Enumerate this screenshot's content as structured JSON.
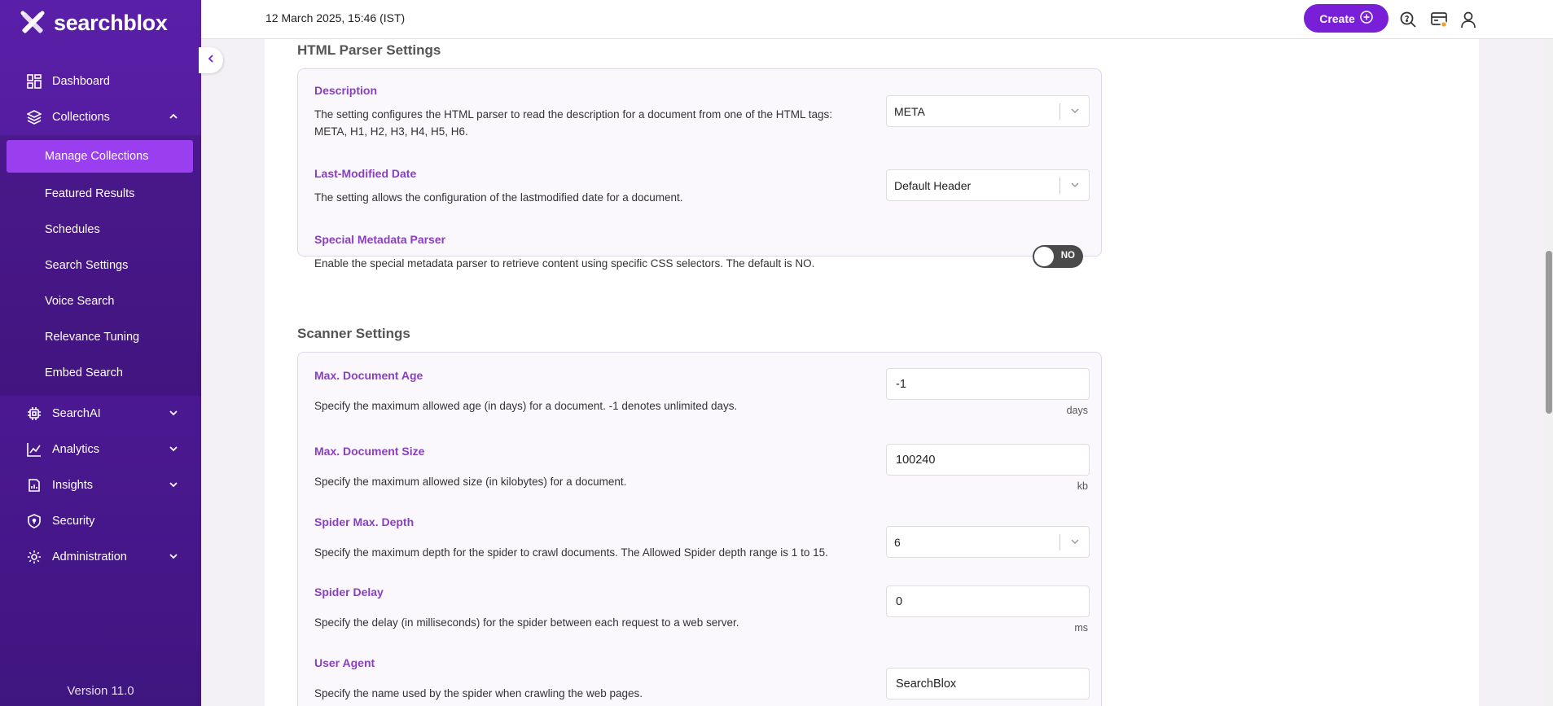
{
  "app": {
    "logo_text": "searchblox",
    "version": "Version 11.0"
  },
  "sidebar": {
    "items": [
      {
        "label": "Dashboard",
        "icon": "dashboard-icon"
      },
      {
        "label": "Collections",
        "icon": "layers-icon",
        "expanded": true,
        "children": [
          "Manage Collections",
          "Featured Results",
          "Schedules",
          "Search Settings",
          "Voice Search",
          "Relevance Tuning",
          "Embed Search"
        ],
        "active_child": "Manage Collections"
      },
      {
        "label": "SearchAI",
        "icon": "chip-icon"
      },
      {
        "label": "Analytics",
        "icon": "chart-icon"
      },
      {
        "label": "Insights",
        "icon": "insights-icon"
      },
      {
        "label": "Security",
        "icon": "shield-icon"
      },
      {
        "label": "Administration",
        "icon": "gear-icon"
      }
    ]
  },
  "topbar": {
    "datetime": "12 March 2025, 15:46 (IST)",
    "create_label": "Create",
    "icons": [
      "search-help-icon",
      "notifications-icon",
      "user-icon"
    ],
    "accent": "#7a1fd8"
  },
  "html_parser": {
    "title": "HTML Parser Settings",
    "description": {
      "label": "Description",
      "text": "The setting configures the HTML parser to read the description for a document from one of the HTML tags: META, H1, H2, H3, H4, H5, H6.",
      "value": "META"
    },
    "last_modified": {
      "label": "Last-Modified Date",
      "text": "The setting allows the configuration of the lastmodified date for a document.",
      "value": "Default Header"
    },
    "special_metadata": {
      "label": "Special Metadata Parser",
      "text": "Enable the special metadata parser to retrieve content using specific CSS selectors. The default is NO.",
      "value": "NO"
    }
  },
  "scanner": {
    "title": "Scanner Settings",
    "max_age": {
      "label": "Max. Document Age",
      "text": "Specify the maximum allowed age (in days) for a document. -1 denotes unlimited days.",
      "value": "-1",
      "unit": "days"
    },
    "max_size": {
      "label": "Max. Document Size",
      "text": "Specify the maximum allowed size (in kilobytes) for a document.",
      "value": "100240",
      "unit": "kb"
    },
    "max_depth": {
      "label": "Spider Max. Depth",
      "text": "Specify the maximum depth for the spider to crawl documents. The Allowed Spider depth range is 1 to 15.",
      "value": "6"
    },
    "delay": {
      "label": "Spider Delay",
      "text": "Specify the delay (in milliseconds) for the spider between each request to a web server.",
      "value": "0",
      "unit": "ms"
    },
    "user_agent": {
      "label": "User Agent",
      "text": "Specify the name used by the spider when crawling the web pages.",
      "value": "SearchBlox"
    }
  }
}
